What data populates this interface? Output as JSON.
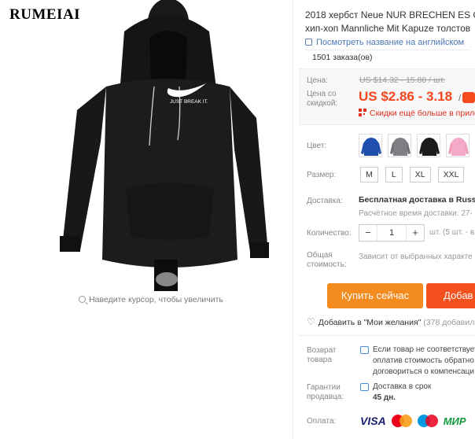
{
  "brand": "RUMEIAI",
  "image_panel": {
    "zoom_hint": "Наведите курсор, чтобы увеличить",
    "print_text": "JUST BREAK IT."
  },
  "product": {
    "title_line1": "2018 хербст Neue NUR BRECHEN ES Ge",
    "title_line2": "хип-хоп Mannliche Mit Kapuze толстов",
    "translate_link": "Посмотреть название на английском",
    "orders": "1501 заказа(ов)"
  },
  "price": {
    "label": "Цена:",
    "old": "US $14.32 - 15.88 / шт.",
    "discount_label_line1": "Цена со",
    "discount_label_line2": "скидкой:",
    "sale": "US $2.86 - 3.18",
    "sale_unit": "/ шт.",
    "app_promo": "Скидки ещё больше в прило"
  },
  "color": {
    "label": "Цвет:",
    "swatches": [
      {
        "name": "blue",
        "hex": "#1f4fae"
      },
      {
        "name": "gray",
        "hex": "#7d7f85"
      },
      {
        "name": "black",
        "hex": "#1b1b1b"
      },
      {
        "name": "pink",
        "hex": "#f4a9c6"
      }
    ]
  },
  "size": {
    "label": "Размер:",
    "options": [
      "M",
      "L",
      "XL",
      "XXL"
    ]
  },
  "shipping": {
    "label": "Доставка:",
    "method": "Бесплатная доставка в Russia",
    "estimate": "Расчётное время доставки: 27-"
  },
  "quantity": {
    "label": "Количество:",
    "value": "1",
    "minus": "−",
    "plus": "+",
    "stock": "шт. (5 шт. - в"
  },
  "total": {
    "label_line1": "Общая",
    "label_line2": "стоимость:",
    "value": "Зависит от выбранных характе"
  },
  "actions": {
    "buy_now": "Купить сейчас",
    "add_to_cart": "Добав"
  },
  "wishlist": {
    "label": "Добавить в \"Мои желания\"",
    "count": "(378 добавили"
  },
  "returns": {
    "label_line1": "Возврат",
    "label_line2": "товара",
    "line1": "Если товар не соответствует",
    "line2": "оплатив стоимость обратно",
    "line3": "договориться о компенсаци"
  },
  "guarantee": {
    "label_line1": "Гарантии",
    "label_line2": "продавца:",
    "line1": "Доставка в срок",
    "line2": "45 дн."
  },
  "payment": {
    "label": "Оплата:",
    "visa": "VISA",
    "mir": "МИР"
  },
  "colors": {
    "accent_orange": "#f48b1e",
    "accent_red": "#f4511e",
    "price_red": "#f5461e",
    "link_blue": "#4a76b5"
  }
}
